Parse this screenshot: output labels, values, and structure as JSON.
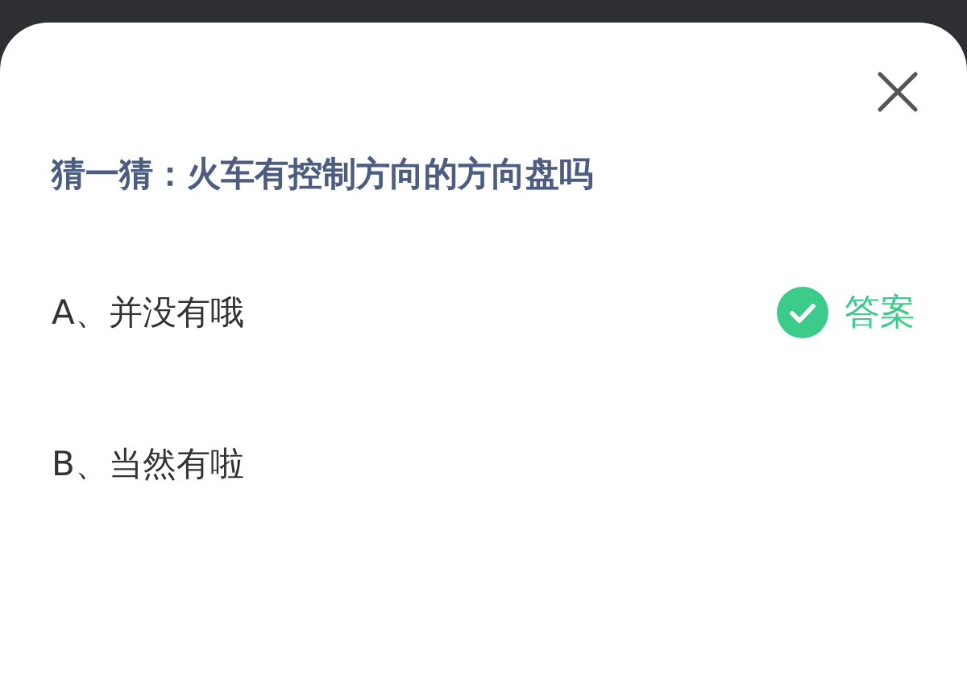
{
  "dialog": {
    "title": "猜一猜：火车有控制方向的方向盘吗",
    "answer_label": "答案",
    "options": [
      {
        "label": "A、并没有哦",
        "correct": true
      },
      {
        "label": "B、当然有啦",
        "correct": false
      }
    ]
  }
}
